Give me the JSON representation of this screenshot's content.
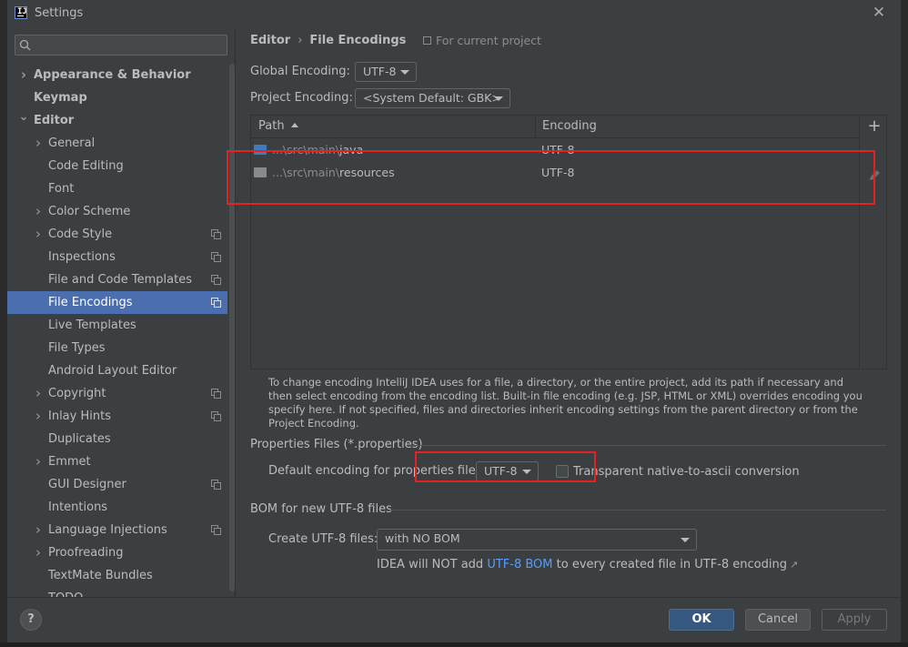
{
  "window": {
    "title": "Settings",
    "app_icon_text": "IJ"
  },
  "sidebar": {
    "search": {
      "placeholder": "Q•",
      "value": ""
    },
    "items": [
      {
        "label": "Appearance & Behavior",
        "level": 0,
        "bold": true,
        "expandable": true,
        "expanded": false,
        "copy_icon": false,
        "selected": false
      },
      {
        "label": "Keymap",
        "level": 0,
        "bold": true,
        "expandable": false,
        "expanded": false,
        "copy_icon": false,
        "selected": false
      },
      {
        "label": "Editor",
        "level": 0,
        "bold": true,
        "expandable": true,
        "expanded": true,
        "copy_icon": false,
        "selected": false
      },
      {
        "label": "General",
        "level": 1,
        "bold": false,
        "expandable": true,
        "expanded": false,
        "copy_icon": false,
        "selected": false
      },
      {
        "label": "Code Editing",
        "level": 1,
        "bold": false,
        "expandable": false,
        "expanded": false,
        "copy_icon": false,
        "selected": false
      },
      {
        "label": "Font",
        "level": 1,
        "bold": false,
        "expandable": false,
        "expanded": false,
        "copy_icon": false,
        "selected": false
      },
      {
        "label": "Color Scheme",
        "level": 1,
        "bold": false,
        "expandable": true,
        "expanded": false,
        "copy_icon": false,
        "selected": false
      },
      {
        "label": "Code Style",
        "level": 1,
        "bold": false,
        "expandable": true,
        "expanded": false,
        "copy_icon": true,
        "selected": false
      },
      {
        "label": "Inspections",
        "level": 1,
        "bold": false,
        "expandable": false,
        "expanded": false,
        "copy_icon": true,
        "selected": false
      },
      {
        "label": "File and Code Templates",
        "level": 1,
        "bold": false,
        "expandable": false,
        "expanded": false,
        "copy_icon": true,
        "selected": false
      },
      {
        "label": "File Encodings",
        "level": 1,
        "bold": false,
        "expandable": false,
        "expanded": false,
        "copy_icon": true,
        "selected": true
      },
      {
        "label": "Live Templates",
        "level": 1,
        "bold": false,
        "expandable": false,
        "expanded": false,
        "copy_icon": false,
        "selected": false
      },
      {
        "label": "File Types",
        "level": 1,
        "bold": false,
        "expandable": false,
        "expanded": false,
        "copy_icon": false,
        "selected": false
      },
      {
        "label": "Android Layout Editor",
        "level": 1,
        "bold": false,
        "expandable": false,
        "expanded": false,
        "copy_icon": false,
        "selected": false
      },
      {
        "label": "Copyright",
        "level": 1,
        "bold": false,
        "expandable": true,
        "expanded": false,
        "copy_icon": true,
        "selected": false
      },
      {
        "label": "Inlay Hints",
        "level": 1,
        "bold": false,
        "expandable": true,
        "expanded": false,
        "copy_icon": true,
        "selected": false
      },
      {
        "label": "Duplicates",
        "level": 1,
        "bold": false,
        "expandable": false,
        "expanded": false,
        "copy_icon": false,
        "selected": false
      },
      {
        "label": "Emmet",
        "level": 1,
        "bold": false,
        "expandable": true,
        "expanded": false,
        "copy_icon": false,
        "selected": false
      },
      {
        "label": "GUI Designer",
        "level": 1,
        "bold": false,
        "expandable": false,
        "expanded": false,
        "copy_icon": true,
        "selected": false
      },
      {
        "label": "Intentions",
        "level": 1,
        "bold": false,
        "expandable": false,
        "expanded": false,
        "copy_icon": false,
        "selected": false
      },
      {
        "label": "Language Injections",
        "level": 1,
        "bold": false,
        "expandable": true,
        "expanded": false,
        "copy_icon": true,
        "selected": false
      },
      {
        "label": "Proofreading",
        "level": 1,
        "bold": false,
        "expandable": true,
        "expanded": false,
        "copy_icon": false,
        "selected": false
      },
      {
        "label": "TextMate Bundles",
        "level": 1,
        "bold": false,
        "expandable": false,
        "expanded": false,
        "copy_icon": false,
        "selected": false
      },
      {
        "label": "TODO",
        "level": 1,
        "bold": false,
        "expandable": false,
        "expanded": false,
        "copy_icon": false,
        "selected": false
      }
    ]
  },
  "main": {
    "breadcrumb": {
      "parent": "Editor",
      "separator": "›",
      "current": "File Encodings"
    },
    "for_project": "For current project",
    "global_encoding": {
      "label": "Global Encoding:",
      "value": "UTF-8"
    },
    "project_encoding": {
      "label": "Project Encoding:",
      "value": "<System Default: GBK>"
    },
    "table": {
      "columns": {
        "path": "Path",
        "encoding": "Encoding"
      },
      "rows": [
        {
          "prefix": "...\\src\\main\\",
          "name": "java",
          "encoding": "UTF-8",
          "icon_color": "#3d7dbf"
        },
        {
          "prefix": "...\\src\\main\\",
          "name": "resources",
          "encoding": "UTF-8",
          "icon_color": "#8a8a8a"
        }
      ]
    },
    "help_text": "To change encoding IntelliJ IDEA uses for a file, a directory, or the entire project, add its path if necessary and then select encoding from the encoding list. Built-in file encoding (e.g. JSP, HTML or XML) overrides encoding you specify here. If not specified, files and directories inherit encoding settings from the parent directory or from the Project Encoding.",
    "properties": {
      "title": "Properties Files (*.properties)",
      "default_label": "Default encoding for properties files:",
      "default_value": "UTF-8",
      "transparent_label": "Transparent native-to-ascii conversion",
      "transparent_checked": false
    },
    "bom": {
      "title": "BOM for new UTF-8 files",
      "create_label": "Create UTF-8 files:",
      "create_value": "with NO BOM",
      "note_before": "IDEA will NOT add",
      "note_link": "UTF-8 BOM",
      "note_after": "to every created file in UTF-8 encoding",
      "note_ext": "↗"
    }
  },
  "footer": {
    "help": "?",
    "ok": "OK",
    "cancel": "Cancel",
    "apply": "Apply"
  },
  "colors": {
    "accent": "#4b6eaf",
    "ok_button": "#365880",
    "link": "#589df6",
    "annotation_red": "#e32323"
  }
}
